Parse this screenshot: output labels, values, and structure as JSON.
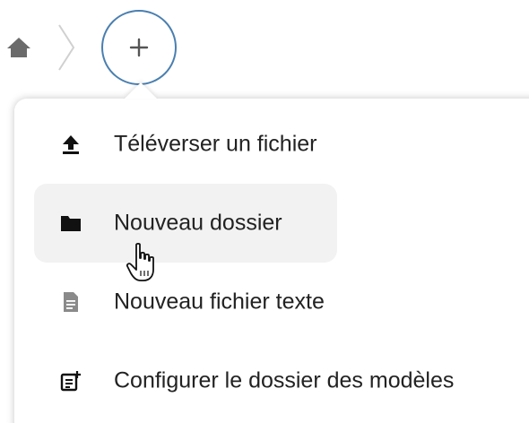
{
  "breadcrumb": {
    "home_icon": "home-icon",
    "add_icon": "plus-icon"
  },
  "new_menu": {
    "items": [
      {
        "label": "Téléverser un fichier",
        "icon": "upload-icon"
      },
      {
        "label": "Nouveau dossier",
        "icon": "folder-icon"
      },
      {
        "label": "Nouveau fichier texte",
        "icon": "text-file-icon"
      },
      {
        "label": "Configurer le dossier des modèles",
        "icon": "template-icon"
      }
    ],
    "hovered_item": "Nouveau dossier"
  },
  "colors": {
    "accent_border": "#4a7fb0",
    "text": "#222222",
    "icon_dark": "#111111",
    "icon_muted": "#8a8a8a",
    "hover_bg": "#f2f2f2"
  }
}
